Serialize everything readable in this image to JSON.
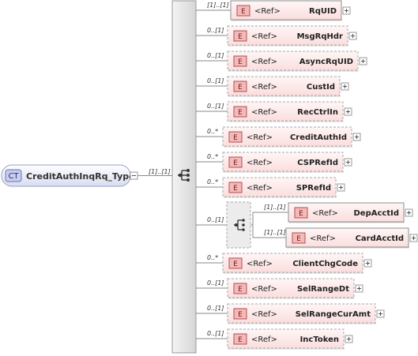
{
  "root": {
    "badge": "CT",
    "name": "CreditAuthInqRq_Type",
    "multiplicity": "[1]..[1]"
  },
  "ref_label": "<Ref>",
  "element_badge": "E",
  "elements": [
    {
      "name": "RqUID",
      "mult": "[1]..[1]",
      "optional": false
    },
    {
      "name": "MsgRqHdr",
      "mult": "0..[1]",
      "optional": true
    },
    {
      "name": "AsyncRqUID",
      "mult": "0..[1]",
      "optional": true
    },
    {
      "name": "CustId",
      "mult": "0..[1]",
      "optional": true
    },
    {
      "name": "RecCtrlIn",
      "mult": "0..[1]",
      "optional": true
    },
    {
      "name": "CreditAuthId",
      "mult": "0..*",
      "optional": true
    },
    {
      "name": "CSPRefId",
      "mult": "0..*",
      "optional": true
    },
    {
      "name": "SPRefId",
      "mult": "0..*",
      "optional": true
    },
    {
      "name": "ClientChgCode",
      "mult": "0..*",
      "optional": true
    },
    {
      "name": "SelRangeDt",
      "mult": "0..[1]",
      "optional": true
    },
    {
      "name": "SelRangeCurAmt",
      "mult": "0..[1]",
      "optional": true
    },
    {
      "name": "IncToken",
      "mult": "0..[1]",
      "optional": true
    }
  ],
  "choice": {
    "mult": "0..[1]",
    "options": [
      {
        "name": "DepAcctId",
        "mult": "[1]..[1]"
      },
      {
        "name": "CardAcctId",
        "mult": "[1]..[1]"
      }
    ]
  }
}
